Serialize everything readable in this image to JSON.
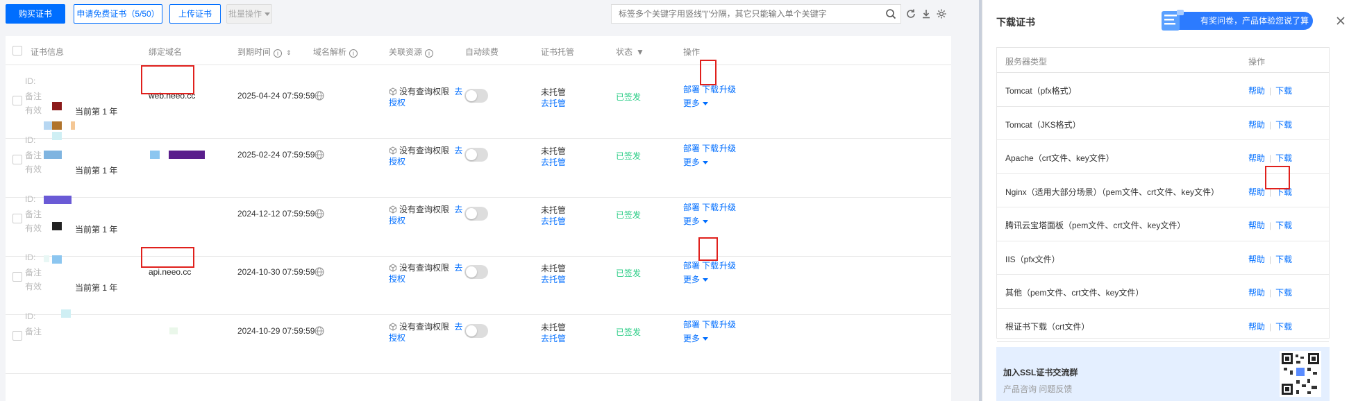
{
  "toolbar": {
    "buy_label": "购买证书",
    "apply_label": "申请免费证书（5/50）",
    "upload_label": "上传证书",
    "batch_label": "批量操作",
    "search_placeholder": "标签多个关键字用竖线\"|\"分隔，其它只能输入单个关键字"
  },
  "table": {
    "headers": {
      "info": "证书信息",
      "domain": "绑定域名",
      "expiry": "到期时间",
      "dns": "域名解析",
      "resource": "关联资源",
      "renew": "自动续费",
      "hosting": "证书托管",
      "status": "状态",
      "ops": "操作"
    },
    "rows": [
      {
        "id_prefix": "ID:",
        "remark_prefix": "备注",
        "valid_prefix": "有效",
        "term": "当前第 1 年",
        "domain": "web.neeo.cc",
        "expiry": "2025-04-24 07:59:59",
        "resource_text": "没有查询权限",
        "resource_link_a": "去",
        "resource_link_b": "授权",
        "hosting": "未托管",
        "hosting_link": "去托管",
        "status": "已签发",
        "op_deploy": "部署",
        "op_download": "下载",
        "op_upgrade": "升级",
        "op_more": "更多"
      },
      {
        "id_prefix": "ID:",
        "remark_prefix": "备注",
        "valid_prefix": "有效",
        "term": "当前第 1 年",
        "domain": "",
        "expiry": "2025-02-24 07:59:59",
        "resource_text": "没有查询权限",
        "resource_link_a": "去",
        "resource_link_b": "授权",
        "hosting": "未托管",
        "hosting_link": "去托管",
        "status": "已签发",
        "op_deploy": "部署",
        "op_download": "下载",
        "op_upgrade": "升级",
        "op_more": "更多"
      },
      {
        "id_prefix": "ID:",
        "remark_prefix": "备注",
        "valid_prefix": "有效",
        "term": "当前第 1 年",
        "domain": "",
        "expiry": "2024-12-12 07:59:59",
        "resource_text": "没有查询权限",
        "resource_link_a": "去",
        "resource_link_b": "授权",
        "hosting": "未托管",
        "hosting_link": "去托管",
        "status": "已签发",
        "op_deploy": "部署",
        "op_download": "下载",
        "op_upgrade": "升级",
        "op_more": "更多"
      },
      {
        "id_prefix": "ID:",
        "remark_prefix": "备注",
        "valid_prefix": "有效",
        "term": "当前第 1 年",
        "domain": "api.neeo.cc",
        "expiry": "2024-10-30 07:59:59",
        "resource_text": "没有查询权限",
        "resource_link_a": "去",
        "resource_link_b": "授权",
        "hosting": "未托管",
        "hosting_link": "去托管",
        "status": "已签发",
        "op_deploy": "部署",
        "op_download": "下载",
        "op_upgrade": "升级",
        "op_more": "更多"
      },
      {
        "id_prefix": "ID:",
        "remark_prefix": "备注",
        "valid_prefix": "",
        "term": "",
        "domain": "",
        "expiry": "2024-10-29 07:59:59",
        "resource_text": "没有查询权限",
        "resource_link_a": "去",
        "resource_link_b": "授权",
        "hosting": "未托管",
        "hosting_link": "去托管",
        "status": "已签发",
        "op_deploy": "部署",
        "op_download": "下载",
        "op_upgrade": "升级",
        "op_more": "更多"
      }
    ]
  },
  "panel": {
    "title": "下载证书",
    "survey_text": "有奖问卷，产品体验您说了算",
    "col_server": "服务器类型",
    "col_ops": "操作",
    "help_label": "帮助",
    "download_label": "下载",
    "servers": [
      "Tomcat（pfx格式）",
      "Tomcat（JKS格式）",
      "Apache（crt文件、key文件）",
      "Nginx（适用大部分场景）（pem文件、crt文件、key文件）",
      "腾讯云宝塔面板（pem文件、crt文件、key文件）",
      "IIS（pfx文件）",
      "其他（pem文件、crt文件、key文件）",
      "根证书下载（crt文件）"
    ],
    "group_title": "加入SSL证书交流群",
    "group_sub": "产品咨询 问题反馈"
  },
  "colors": {
    "accent": "#006eff",
    "success": "#29cc85",
    "highlight": "#e0201c"
  }
}
